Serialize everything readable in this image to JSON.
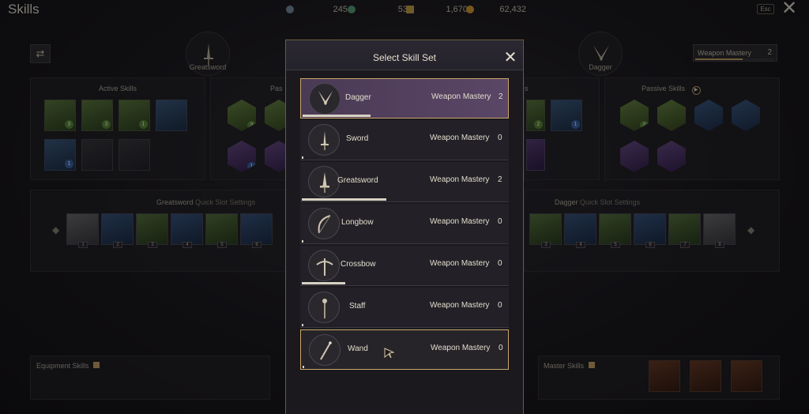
{
  "screen": {
    "title": "Skills",
    "currencies": [
      {
        "icon": "silver-orb-icon",
        "value": "245",
        "color": "#7a8fa0"
      },
      {
        "icon": "green-orb-icon",
        "value": "53",
        "color": "#5aa07a"
      },
      {
        "icon": "gold-ticket-icon",
        "value": "1,670",
        "color": "#c9a24a"
      },
      {
        "icon": "gold-coin-icon",
        "value": "62,432",
        "color": "#d9a030"
      }
    ],
    "esc_label": "Esc",
    "left_weapon": "Greatsword",
    "right_weapon": "Dagger",
    "mastery_box": {
      "label": "Weapon Mastery",
      "value": "2"
    },
    "active_skills_label": "Active Skills",
    "passive_skills_label_left": "Pas",
    "passive_skills_label_right": "Passive Skills",
    "passive_fragment_right": "s",
    "left_quick_slot": {
      "weapon": "Greatsword",
      "suffix": "Quick Slot Settings"
    },
    "right_quick_slot": {
      "weapon": "Dagger",
      "suffix": "Quick Slot Settings"
    },
    "left_slots": [
      "1",
      "2",
      "3",
      "4",
      "5",
      "6"
    ],
    "right_slots": [
      "3",
      "4",
      "5",
      "6",
      "7",
      "8"
    ],
    "left_skill_levels": [
      "3",
      "3",
      "1",
      "1"
    ],
    "passive_levels_left": [
      "3",
      "1"
    ],
    "right_skill_levels": [
      "2",
      "1"
    ],
    "passive_levels_right": [
      "2"
    ],
    "equipment_skills_label": "Equipment Skills",
    "master_skills_label": "Master Skills"
  },
  "modal": {
    "title": "Select Skill Set",
    "weapons": [
      {
        "name": "Dagger",
        "icon": "dagger-icon",
        "mastery_label": "Weapon Mastery",
        "mastery_value": "2",
        "progress": 0.33,
        "state": "selected"
      },
      {
        "name": "Sword",
        "icon": "sword-icon",
        "mastery_label": "Weapon Mastery",
        "mastery_value": "0",
        "progress": 0.0,
        "state": "normal"
      },
      {
        "name": "Greatsword",
        "icon": "greatsword-icon",
        "mastery_label": "Weapon Mastery",
        "mastery_value": "2",
        "progress": 0.41,
        "state": "normal"
      },
      {
        "name": "Longbow",
        "icon": "longbow-icon",
        "mastery_label": "Weapon Mastery",
        "mastery_value": "0",
        "progress": 0.0,
        "state": "normal"
      },
      {
        "name": "Crossbow",
        "icon": "crossbow-icon",
        "mastery_label": "Weapon Mastery",
        "mastery_value": "0",
        "progress": 0.21,
        "state": "normal"
      },
      {
        "name": "Staff",
        "icon": "staff-icon",
        "mastery_label": "Weapon Mastery",
        "mastery_value": "0",
        "progress": 0.0,
        "state": "normal"
      },
      {
        "name": "Wand",
        "icon": "wand-icon",
        "mastery_label": "Weapon Mastery",
        "mastery_value": "0",
        "progress": 0.0,
        "state": "hover"
      }
    ]
  }
}
